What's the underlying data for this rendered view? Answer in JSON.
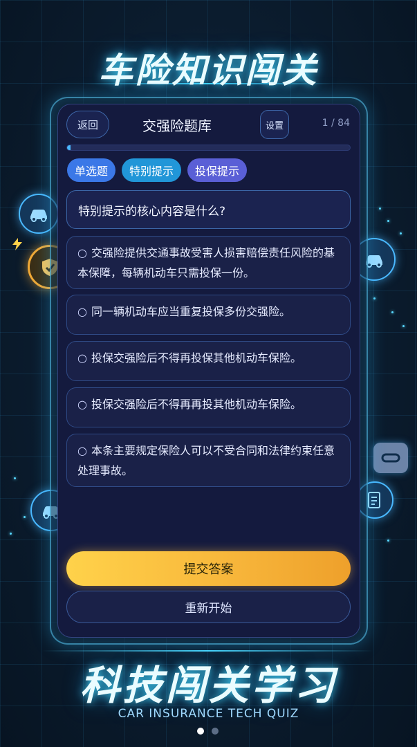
{
  "hero_title": "车险知识闯关",
  "header": {
    "back_label": "返回",
    "title": "交强险题库",
    "settings_label": "设置",
    "counter": "1 / 84"
  },
  "progress": {
    "current": 1,
    "total": 84
  },
  "tags": [
    {
      "label": "单选题",
      "color": "#3b78e7"
    },
    {
      "label": "特别提示",
      "color": "#2196d8"
    },
    {
      "label": "投保提示",
      "color": "#5a5fd6"
    }
  ],
  "question": "特别提示的核心内容是什么?",
  "options": [
    {
      "radio": "○",
      "text": "交强险提供交通事故受害人损害赔偿责任风险的基本保障，每辆机动车只需投保一份。"
    },
    {
      "radio": "○",
      "text": "同一辆机动车应当重复投保多份交强险。"
    },
    {
      "radio": "○",
      "text": "投保交强险后不得再投保其他机动车保险。"
    },
    {
      "radio": "○",
      "text": "投保交强险后不得再再投其他机动车保险。"
    },
    {
      "radio": "○",
      "text": "本条主要规定保险人可以不受合同和法律约束任意处理事故。"
    }
  ],
  "actions": {
    "submit_label": "提交答案",
    "restart_label": "重新开始"
  },
  "bottom_title": "科技闯关学习",
  "subtitle": "CAR INSURANCE TECH QUIZ",
  "pagination": {
    "count": 2,
    "active": 0
  },
  "decor_icons": [
    "car-icon",
    "shield-car-icon",
    "car-icon",
    "car-icon",
    "document-icon",
    "chat-icon",
    "lightning-icon"
  ]
}
